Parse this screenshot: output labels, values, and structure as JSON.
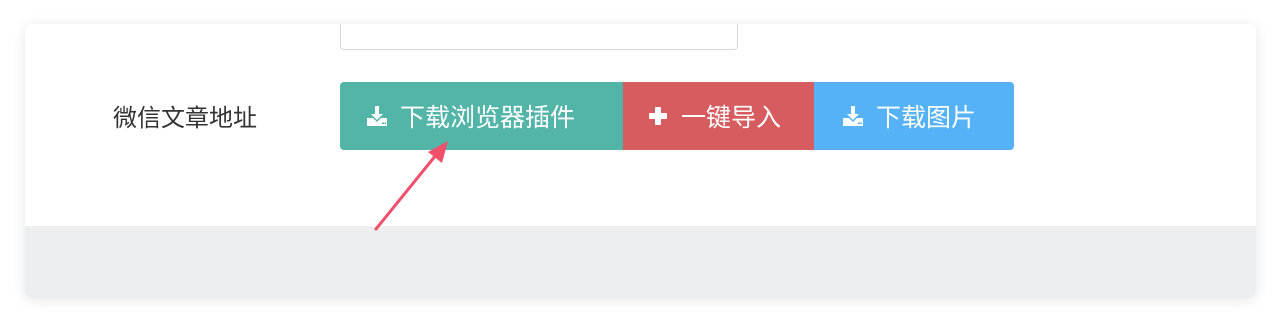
{
  "form": {
    "field_label": "微信文章地址"
  },
  "buttons": {
    "download_plugin": {
      "label": "下载浏览器插件",
      "icon": "download-icon",
      "color": "#52b5a7"
    },
    "one_click_import": {
      "label": "一键导入",
      "icon": "plus-icon",
      "color": "#d65c5f"
    },
    "download_image": {
      "label": "下载图片",
      "icon": "download-icon",
      "color": "#56b2f7"
    }
  },
  "annotation": {
    "arrow_color": "#f0506a",
    "points_to": "download_plugin"
  }
}
